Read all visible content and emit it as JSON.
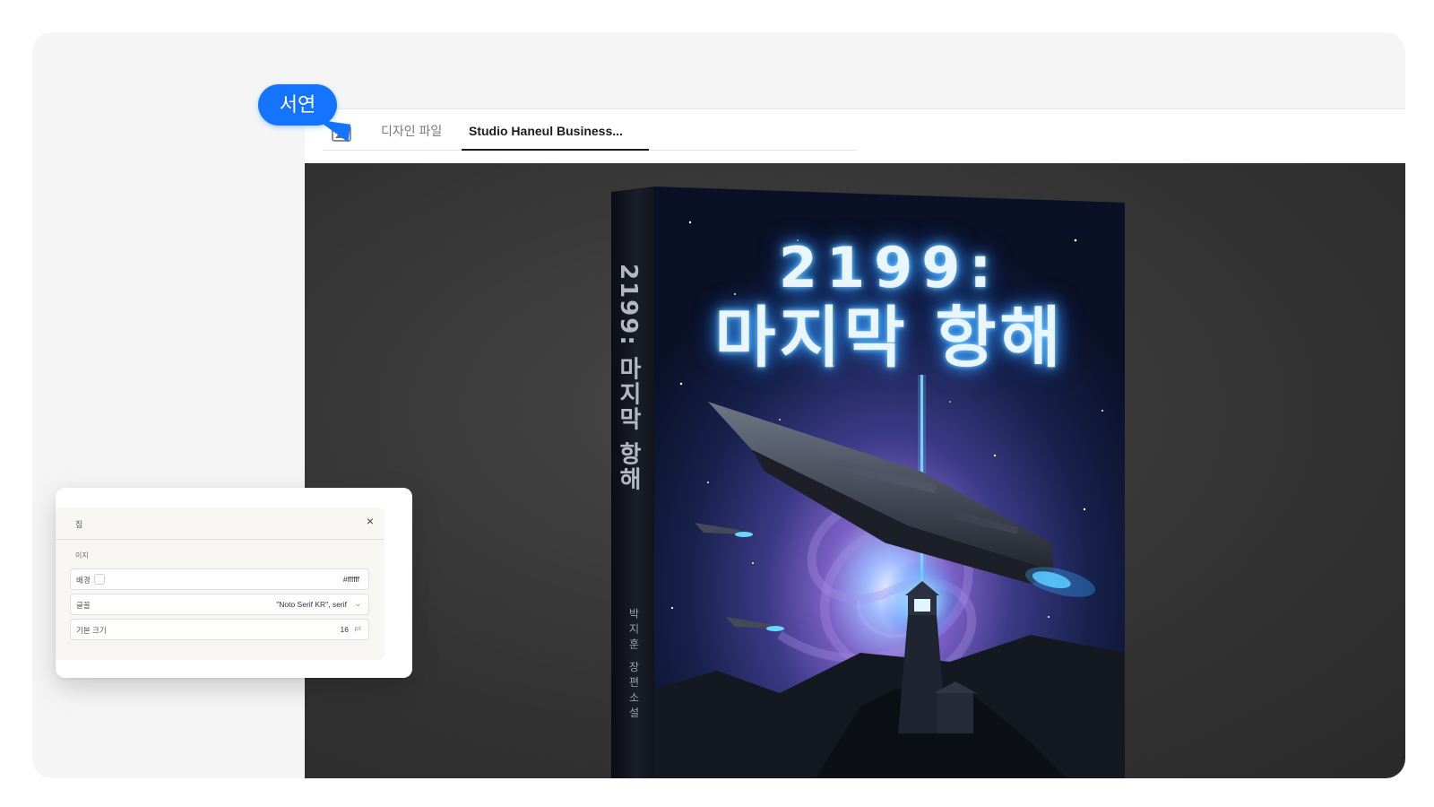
{
  "bubble": {
    "label": "서연",
    "color": "#1473ff"
  },
  "tabs": [
    {
      "label": "디자인 파일",
      "active": false
    },
    {
      "label": "Studio Haneul Business...",
      "active": true
    }
  ],
  "book": {
    "title_line1": "2199:",
    "title_line2": "마지막 항해",
    "spine_title": "2199: 마지막 항해",
    "spine_author": "박지훈 장편소설"
  },
  "settings_panel": {
    "title": "집",
    "section_label": "이지",
    "rows": [
      {
        "label": "배경",
        "value": "#ffffff"
      },
      {
        "label": "글꼴",
        "value": "\"Noto Serif KR\", serif"
      },
      {
        "label": "기본 크기",
        "value": "16",
        "unit": "px"
      }
    ]
  }
}
